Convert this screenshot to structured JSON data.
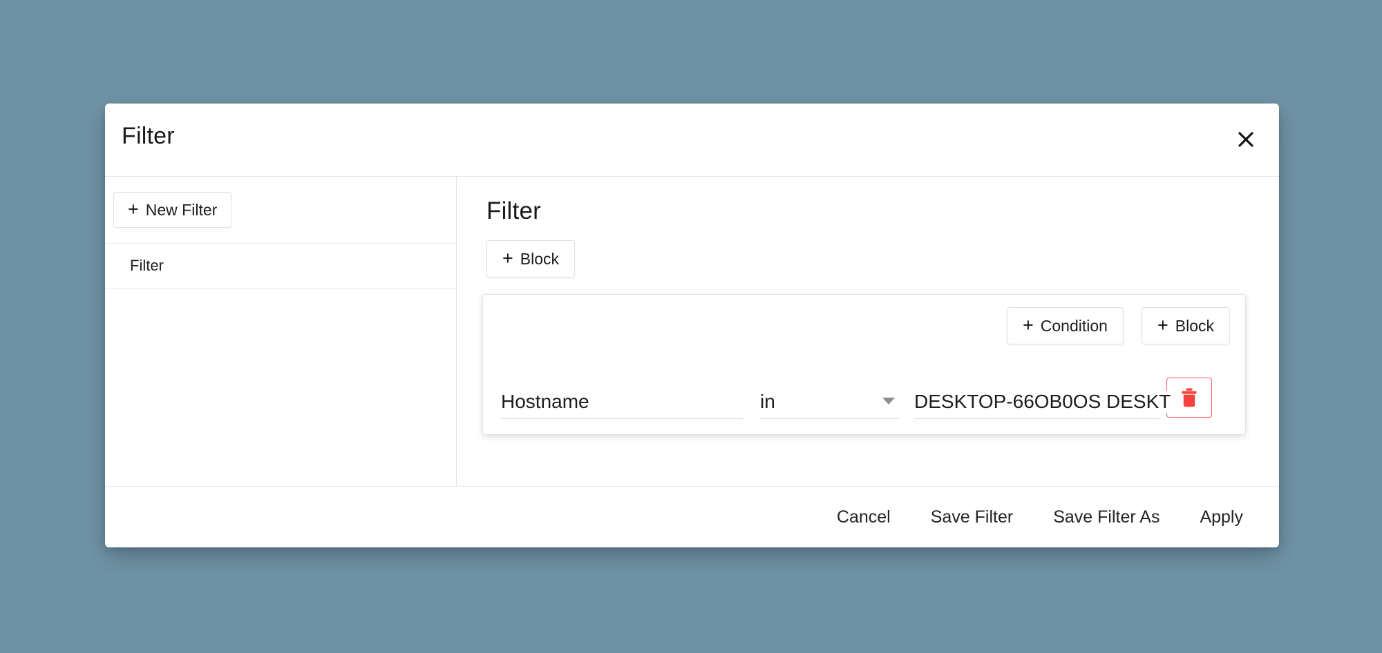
{
  "theme": {
    "backdrop_color": "#6f93a6",
    "dialog_background": "#ffffff",
    "text_color": "#1c1c1c",
    "border_color": "#e2e2e2",
    "danger_color": "#f4574f",
    "caret_color": "#8d8d8d"
  },
  "dialog": {
    "title": "Filter",
    "close_icon": "close-icon"
  },
  "sidebar": {
    "new_filter_label": "New Filter",
    "new_filter_icon": "plus-icon",
    "items": [
      {
        "label": "Filter"
      }
    ]
  },
  "main": {
    "heading": "Filter",
    "add_block_label": "Block",
    "add_block_icon": "plus-icon",
    "block": {
      "add_condition_label": "Condition",
      "add_condition_icon": "plus-icon",
      "add_block_label": "Block",
      "add_block_icon": "plus-icon",
      "conditions": [
        {
          "attribute": "Hostname",
          "operator": "in",
          "operator_icon": "chevron-down-icon",
          "value": "DESKTOP-66OB0OS DESKT",
          "delete_icon": "trash-icon"
        }
      ]
    }
  },
  "footer": {
    "cancel_label": "Cancel",
    "save_filter_label": "Save Filter",
    "save_filter_as_label": "Save Filter As",
    "apply_label": "Apply"
  }
}
